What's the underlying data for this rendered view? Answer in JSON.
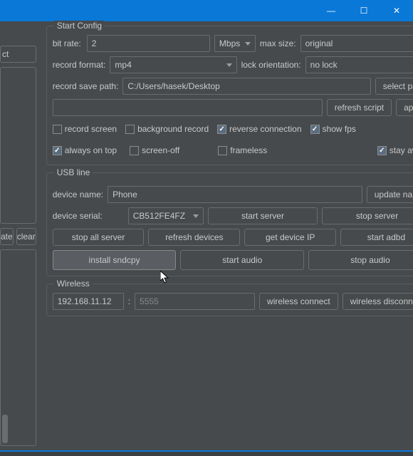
{
  "titlebar": {
    "min": "—",
    "max": "☐",
    "close": "✕"
  },
  "left": {
    "btn1": "ct",
    "btn2": "ate",
    "btn3": "clear"
  },
  "start": {
    "title": "Start Config",
    "bitrate_lbl": "bit rate:",
    "bitrate_val": "2",
    "bitrate_unit": "Mbps",
    "maxsize_lbl": "max size:",
    "maxsize_val": "original",
    "format_lbl": "record format:",
    "format_val": "mp4",
    "lock_lbl": "lock orientation:",
    "lock_val": "no lock",
    "path_lbl": "record save path:",
    "path_val": "C:/Users/hasek/Desktop",
    "selpath": "select path",
    "refresh": "refresh script",
    "apply": "apply",
    "cb": {
      "record": "record screen",
      "bg": "background record",
      "reverse": "reverse connection",
      "fps": "show fps",
      "aot": "always on top",
      "off": "screen-off",
      "frameless": "frameless",
      "awake": "stay awake"
    }
  },
  "usb": {
    "title": "USB line",
    "devname_lbl": "device name:",
    "devname_val": "Phone",
    "update": "update name",
    "serial_lbl": "device serial:",
    "serial_val": "CB512FE4FZ",
    "startsrv": "start server",
    "stopsrv": "stop server",
    "stopall": "stop all server",
    "refresh": "refresh devices",
    "getip": "get device IP",
    "startadbd": "start adbd",
    "sndcpy": "install sndcpy",
    "startaudio": "start audio",
    "stopaudio": "stop audio"
  },
  "wifi": {
    "title": "Wireless",
    "ip": "192.168.11.12",
    "colon": ":",
    "port_ph": "5555",
    "connect": "wireless connect",
    "disconnect": "wireless disconnect"
  }
}
